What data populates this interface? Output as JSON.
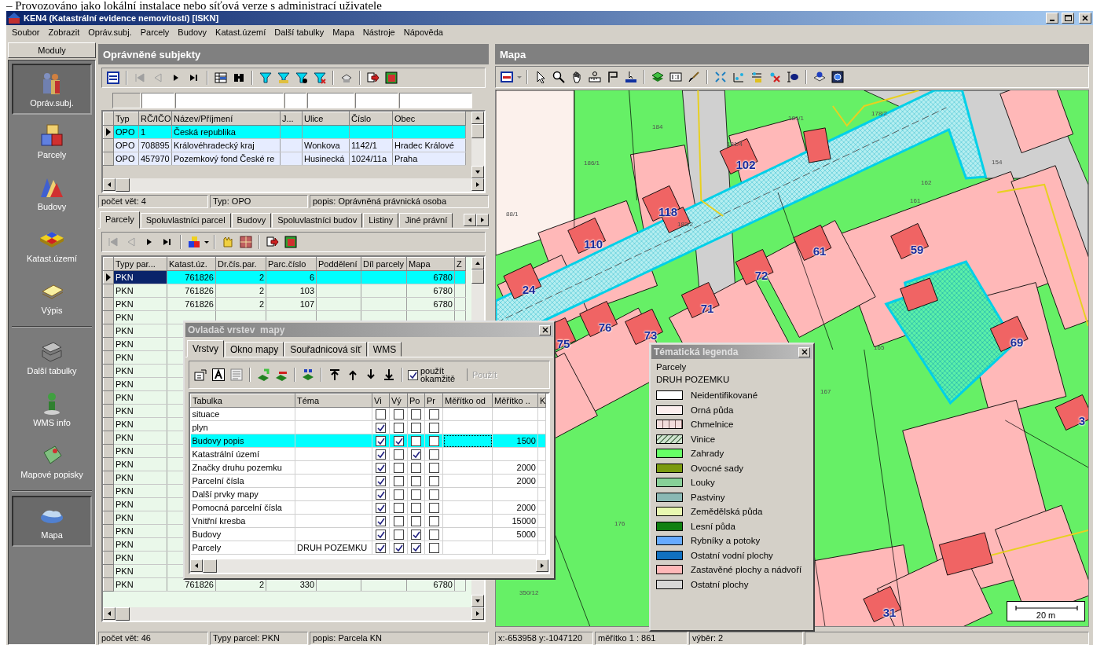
{
  "caption": "–  Provozováno jako lokální instalace nebo síťová verze s administrací uživatele",
  "window": {
    "title": "KEN4 (Katastrální evidence nemovitostí)  [ISKN]"
  },
  "menu": [
    "Soubor",
    "Zobrazit",
    "Opráv.subj.",
    "Parcely",
    "Budovy",
    "Katast.území",
    "Další tabulky",
    "Mapa",
    "Nástroje",
    "Nápověda"
  ],
  "modules": {
    "title": "Moduly",
    "items": [
      {
        "label": "Opráv.subj.",
        "selected": true
      },
      {
        "label": "Parcely",
        "selected": false
      },
      {
        "label": "Budovy",
        "selected": false
      },
      {
        "label": "Katast.území",
        "selected": false
      },
      {
        "label": "Výpis",
        "selected": false
      },
      {
        "label": "Další tabulky",
        "selected": false,
        "separator_before": true
      },
      {
        "label": "WMS info",
        "selected": false
      },
      {
        "label": "Mapové popisky",
        "selected": false
      },
      {
        "label": "Mapa",
        "selected": true,
        "separator_before": true
      }
    ]
  },
  "subjects": {
    "title": "Oprávněné subjekty",
    "columns": [
      "Typ",
      "RČ/IČO",
      "Název/Příjmení",
      "J...",
      "Ulice",
      "Číslo",
      "Obec"
    ],
    "rows": [
      {
        "typ": "OPO",
        "rc_ico": "1",
        "nazev": "Česká republika",
        "selected": true
      },
      {
        "typ": "OPO",
        "rc_ico": "708895",
        "nazev": "Královéhradecký kraj",
        "ulice": "Wonkova",
        "cislo": "1142/1",
        "obec": "Hradec Králové",
        "selected": false
      },
      {
        "typ": "OPO",
        "rc_ico": "457970",
        "nazev": "Pozemkový fond České re",
        "ulice": "Husinecká",
        "cislo": "1024/11a",
        "obec": "Praha",
        "selected": false
      }
    ],
    "status": [
      "počet vět: 4",
      "Typ: OPO",
      "popis: Oprávněná právnická osoba"
    ]
  },
  "detail_tabs": [
    {
      "label": "Parcely",
      "selected": true
    },
    {
      "label": "Spoluvlastníci parcel",
      "selected": false
    },
    {
      "label": "Budovy",
      "selected": false
    },
    {
      "label": "Spoluvlastníci budov",
      "selected": false
    },
    {
      "label": "Listiny",
      "selected": false
    },
    {
      "label": "Jiné právní",
      "selected": false
    }
  ],
  "parcels": {
    "columns": [
      "Typy par...",
      "Katast.úz.",
      "Dr.čís.par.",
      "Parc.číslo",
      "Poddělení",
      "Díl parcely",
      "Mapa",
      "Z"
    ],
    "rows": [
      {
        "typ": "PKN",
        "katast": "761826",
        "dr_cis": "2",
        "parc_cislo": "6",
        "mapa": "6780",
        "selected": true
      },
      {
        "typ": "PKN",
        "katast": "761826",
        "dr_cis": "2",
        "parc_cislo": "103",
        "mapa": "6780",
        "selected": false
      },
      {
        "typ": "PKN",
        "katast": "761826",
        "dr_cis": "2",
        "parc_cislo": "107",
        "mapa": "6780",
        "selected": false
      },
      {
        "typ": "PKN",
        "selected": false
      },
      {
        "typ": "PKN",
        "selected": false
      },
      {
        "typ": "PKN",
        "selected": false
      },
      {
        "typ": "PKN",
        "selected": false
      },
      {
        "typ": "PKN",
        "selected": false
      },
      {
        "typ": "PKN",
        "selected": false
      },
      {
        "typ": "PKN",
        "selected": false
      },
      {
        "typ": "PKN",
        "selected": false
      },
      {
        "typ": "PKN",
        "selected": false
      },
      {
        "typ": "PKN",
        "selected": false
      },
      {
        "typ": "PKN",
        "selected": false
      },
      {
        "typ": "PKN",
        "selected": false
      },
      {
        "typ": "PKN",
        "selected": false
      },
      {
        "typ": "PKN",
        "selected": false
      },
      {
        "typ": "PKN",
        "selected": false
      },
      {
        "typ": "PKN",
        "selected": false
      },
      {
        "typ": "PKN",
        "selected": false
      },
      {
        "typ": "PKN",
        "selected": false
      },
      {
        "typ": "PKN",
        "selected": false
      },
      {
        "typ": "PKN",
        "selected": false
      },
      {
        "typ": "PKN",
        "katast": "761826",
        "dr_cis": "2",
        "parc_cislo": "330",
        "mapa": "6780",
        "selected": false
      }
    ],
    "status": [
      "počet vět: 46",
      "Typy parcel: PKN",
      "popis: Parcela KN"
    ]
  },
  "map": {
    "title": "Mapa",
    "building_numbers": [
      "102",
      "118",
      "110",
      "61",
      "59",
      "24",
      "72",
      "71",
      "73",
      "76",
      "75",
      "69",
      "3",
      "31"
    ],
    "parcel_numbers": [
      "178/2",
      "184",
      "186/1",
      "88/1",
      "181/1",
      "181/4",
      "154",
      "161",
      "165",
      "167",
      "176",
      "350/12",
      "183/2",
      "162"
    ],
    "scale": "20 m",
    "status": [
      "x:-653958  y:-1047120",
      "měřítko 1 : 861",
      "výběr: 2"
    ]
  },
  "layer_dialog": {
    "title": "Ovladač vrstev  mapy",
    "tabs": [
      {
        "label": "Vrstvy",
        "selected": true
      },
      {
        "label": "Okno mapy",
        "selected": false
      },
      {
        "label": "Souřadnicová síť",
        "selected": false
      },
      {
        "label": "WMS",
        "selected": false
      }
    ],
    "apply_now": {
      "label": "použít okamžitě",
      "checked": true
    },
    "apply_button": {
      "label": "Použít",
      "disabled": true
    },
    "columns": [
      "Tabulka",
      "Téma",
      "Vi",
      "Vý",
      "Po",
      "Pr",
      "Měřítko od",
      "Měřítko ..",
      "K"
    ],
    "rows": [
      {
        "tabulka": "situace",
        "vi": false,
        "vy": false,
        "po": false,
        "pr": false,
        "selected": false
      },
      {
        "tabulka": "plyn",
        "vi": true,
        "vy": false,
        "po": false,
        "pr": false,
        "selected": false
      },
      {
        "tabulka": "Budovy popis",
        "vi": true,
        "vy": true,
        "po": false,
        "pr": false,
        "column_8": "1500",
        "selected": true
      },
      {
        "tabulka": "Katastrální území",
        "vi": true,
        "vy": false,
        "po": true,
        "pr": false,
        "selected": false
      },
      {
        "tabulka": "Značky druhu pozemku",
        "vi": true,
        "vy": false,
        "po": false,
        "pr": false,
        "column_8": "2000",
        "selected": false
      },
      {
        "tabulka": "Parcelní čísla",
        "vi": true,
        "vy": false,
        "po": false,
        "pr": false,
        "column_8": "2000",
        "selected": false
      },
      {
        "tabulka": "Další prvky mapy",
        "vi": true,
        "vy": false,
        "po": false,
        "pr": false,
        "selected": false
      },
      {
        "tabulka": "Pomocná parcelní čísla",
        "vi": true,
        "vy": false,
        "po": false,
        "pr": false,
        "column_8": "2000",
        "selected": false
      },
      {
        "tabulka": "Vnitřní kresba",
        "vi": true,
        "vy": false,
        "po": false,
        "pr": false,
        "column_8": "15000",
        "selected": false
      },
      {
        "tabulka": "Budovy",
        "vi": true,
        "vy": false,
        "po": true,
        "pr": false,
        "column_8": "5000",
        "selected": false
      },
      {
        "tabulka": "Parcely",
        "tema": "DRUH POZEMKU",
        "vi": true,
        "vy": true,
        "po": true,
        "pr": false,
        "selected": false
      }
    ]
  },
  "legend": {
    "title": "Tématická legenda",
    "layer": "Parcely",
    "theme": "DRUH POZEMKU",
    "items": [
      {
        "label": "Neidentifikované",
        "color": "#ffffff",
        "kind": "fill"
      },
      {
        "label": "Orná půda",
        "color": "#fdeeee",
        "kind": "fill"
      },
      {
        "label": "Chmelnice",
        "color": "#f2dcdc",
        "kind": "stripes"
      },
      {
        "label": "Vinice",
        "color": "#cfe3cf",
        "kind": "hatch"
      },
      {
        "label": "Zahrady",
        "color": "#66ff66",
        "kind": "fill"
      },
      {
        "label": "Ovocné sady",
        "color": "#7a9a10",
        "kind": "fill"
      },
      {
        "label": "Louky",
        "color": "#88d098",
        "kind": "fill"
      },
      {
        "label": "Pastviny",
        "color": "#8ab8b4",
        "kind": "fill"
      },
      {
        "label": "Zemědělská půda",
        "color": "#e8f8b0",
        "kind": "fill"
      },
      {
        "label": "Lesní půda",
        "color": "#108010",
        "kind": "fill"
      },
      {
        "label": "Rybníky a potoky",
        "color": "#66aaff",
        "kind": "fill"
      },
      {
        "label": "Ostatní vodní plochy",
        "color": "#1070c0",
        "kind": "fill"
      },
      {
        "label": "Zastavěné plochy a nádvoří",
        "color": "#ffb8b8",
        "kind": "fill"
      },
      {
        "label": "Ostatní plochy",
        "color": "#d8d8d8",
        "kind": "fill"
      }
    ]
  }
}
